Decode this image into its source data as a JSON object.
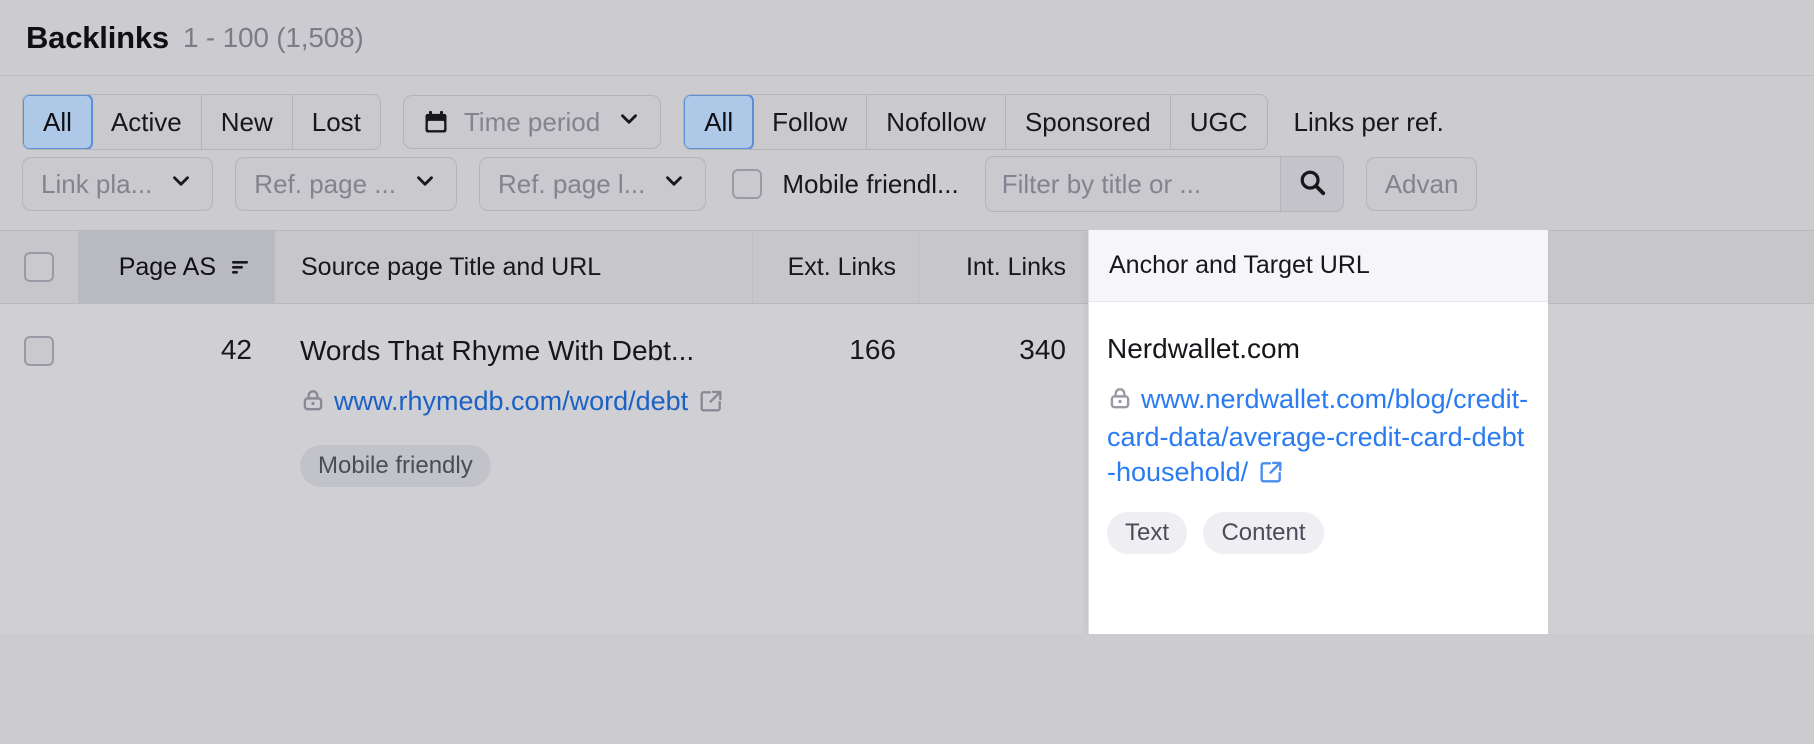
{
  "header": {
    "title": "Backlinks",
    "count": "1 - 100 (1,508)"
  },
  "filters": {
    "status_group": {
      "options": [
        "All",
        "Active",
        "New",
        "Lost"
      ],
      "selected": "All"
    },
    "time_period": {
      "label": "Time period",
      "icon": "calendar-icon",
      "chevron": "chevron-down-icon"
    },
    "follow_group": {
      "options": [
        "All",
        "Follow",
        "Nofollow",
        "Sponsored",
        "UGC"
      ],
      "selected": "All"
    },
    "links_per_ref_label": "Links per ref.",
    "link_placement": {
      "label": "Link pla...",
      "chevron": "chevron-down-icon"
    },
    "ref_page": {
      "label": "Ref. page ...",
      "chevron": "chevron-down-icon"
    },
    "ref_page_lang": {
      "label": "Ref. page l...",
      "chevron": "chevron-down-icon"
    },
    "mobile_friendly": {
      "label": "Mobile friendl...",
      "checked": false
    },
    "search": {
      "placeholder": "Filter by title or ...",
      "value": "",
      "icon": "search-icon"
    },
    "advanced_label": "Advan"
  },
  "table": {
    "columns": {
      "select_all": "",
      "page_as": "Page AS",
      "page_as_sort_icon": "sort-icon",
      "source": "Source page Title and URL",
      "ext_links": "Ext. Links",
      "int_links": "Int. Links",
      "anchor": "Anchor and Target URL"
    },
    "rows": [
      {
        "page_as": "42",
        "source_title": "Words That Rhyme With Debt...",
        "source_url_domain": "www.rhymedb.com",
        "source_url_path": "/word/debt",
        "source_lock_icon": "lock-icon",
        "source_ext_icon": "external-link-icon",
        "source_badges": [
          "Mobile friendly"
        ],
        "ext_links": "166",
        "int_links": "340",
        "anchor_text": "Nerdwallet.com",
        "target_url_domain": "www.nerdwallet.com",
        "target_url_path": "/blog/credit-card-data/average-credit-card-debt-household/",
        "target_lock_icon": "lock-icon",
        "target_ext_icon": "external-link-icon",
        "anchor_badges": [
          "Text",
          "Content"
        ]
      }
    ]
  },
  "colors": {
    "accent_blue": "#5c8fd6",
    "selected_bg": "#aec9e8",
    "link_blue": "#1b62c4",
    "target_link_blue": "#2b7bf0",
    "page_bg": "#ccccd0",
    "row_bg": "#d0d0d4",
    "panel_bg": "#ffffff"
  }
}
